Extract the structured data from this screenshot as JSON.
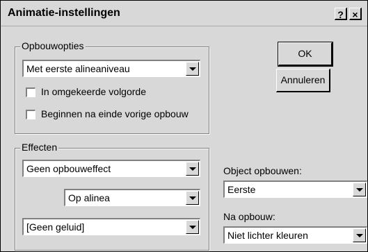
{
  "window": {
    "title": "Animatie-instellingen",
    "help_btn": "?",
    "close_btn": "×"
  },
  "opbouwopties": {
    "label": "Opbouwopties",
    "combo_value": "Met eerste alineaniveau",
    "reverse_label": "In omgekeerde volgorde",
    "reverse_checked": false,
    "after_label": "Beginnen na einde vorige opbouw",
    "after_checked": false
  },
  "effecten": {
    "label": "Effecten",
    "effect_value": "Geen opbouweffect",
    "by_value": "Op alinea",
    "sound_value": "[Geen geluid]"
  },
  "buttons": {
    "ok": "OK",
    "cancel": "Annuleren"
  },
  "object_opbouwen": {
    "label": "Object opbouwen:",
    "value": "Eerste"
  },
  "na_opbouw": {
    "label": "Na opbouw:",
    "value": "Niet lichter kleuren"
  }
}
